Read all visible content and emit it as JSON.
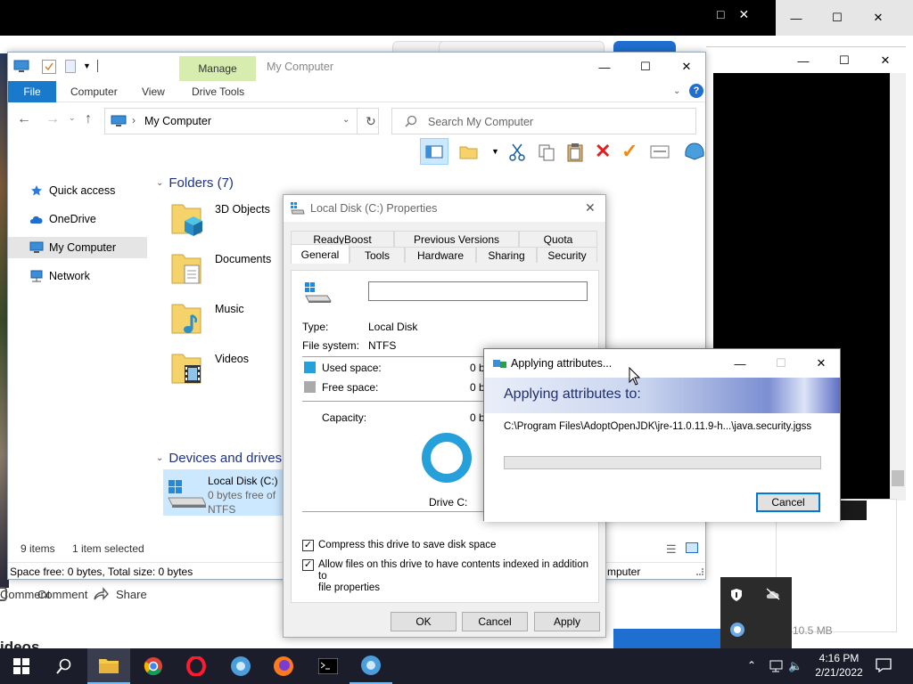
{
  "explorer": {
    "title": "My Computer",
    "context_tab": "Manage",
    "ribbon_tabs": [
      "File",
      "Computer",
      "View",
      "Drive Tools"
    ],
    "address": "My Computer",
    "search_placeholder": "Search My Computer",
    "nav": [
      "Quick access",
      "OneDrive",
      "My Computer",
      "Network"
    ],
    "folders_header": "Folders (7)",
    "folders": [
      "3D Objects",
      "Documents",
      "Music",
      "Videos"
    ],
    "devices_header": "Devices and drives",
    "drive": {
      "name": "Local Disk (C:)",
      "free": "0 bytes free of",
      "fs": "NTFS"
    },
    "status_items": "9 items",
    "status_selected": "1 item selected",
    "status_space": "Space free: 0 bytes, Total size: 0 bytes",
    "status_right": "mputer"
  },
  "properties": {
    "title": "Local Disk (C:) Properties",
    "tabs_row1": [
      "ReadyBoost",
      "Previous Versions",
      "Quota"
    ],
    "tabs_row2": [
      "General",
      "Tools",
      "Hardware",
      "Sharing",
      "Security"
    ],
    "type_label": "Type:",
    "type_value": "Local Disk",
    "fs_label": "File system:",
    "fs_value": "NTFS",
    "used_label": "Used space:",
    "used_value": "0 by",
    "free_label": "Free space:",
    "free_value": "0 by",
    "capacity_label": "Capacity:",
    "capacity_value": "0 by",
    "drive_label": "Drive C:",
    "compress_label": "Compress this drive to save disk space",
    "index_label_1": "Allow files on this drive to have contents indexed in addition to",
    "index_label_2": "file properties",
    "ok": "OK",
    "cancel": "Cancel",
    "apply": "Apply"
  },
  "apply_dialog": {
    "title": "Applying attributes...",
    "heading": "Applying attributes to:",
    "path": "C:\\Program Files\\AdoptOpenJDK\\jre-11.0.11.9-h...\\java.security.jgss",
    "progress": 0,
    "cancel": "Cancel"
  },
  "background": {
    "comment": "Comment",
    "share": "Share",
    "videos_partial": "ideos",
    "size_partial": "10.5 MB"
  },
  "taskbar": {
    "time": "4:16 PM",
    "date": "2/21/2022"
  },
  "colors": {
    "accent": "#0078d7",
    "file_tab": "#1979ca",
    "manage_tab": "#d7edb0",
    "selection": "#cce8ff",
    "taskbar": "#1b1d2b"
  }
}
